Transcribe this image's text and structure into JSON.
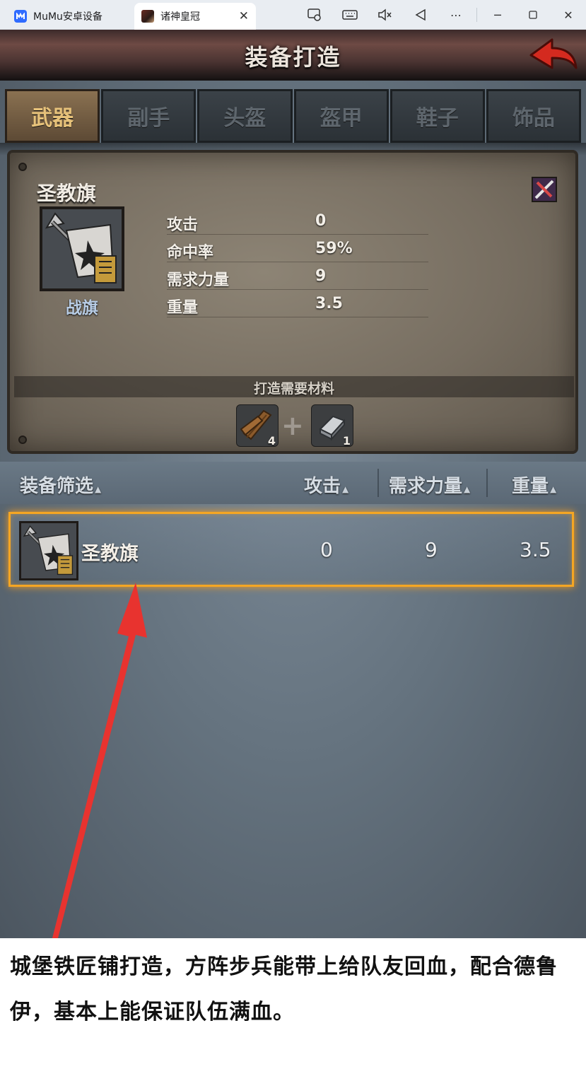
{
  "window": {
    "tabs": [
      {
        "label": "MuMu安卓设备",
        "icon": "mumu-logo-icon"
      },
      {
        "label": "诸神皇冠",
        "icon": "game-icon",
        "active": true
      }
    ],
    "controls": [
      "screen-record-icon",
      "keyboard-icon",
      "mute-icon",
      "back-icon",
      "more-icon",
      "minimize-icon",
      "maximize-icon",
      "close-icon"
    ]
  },
  "header": {
    "title": "装备打造"
  },
  "category_tabs": [
    {
      "label": "武器",
      "active": true
    },
    {
      "label": "副手",
      "active": false
    },
    {
      "label": "头盔",
      "active": false
    },
    {
      "label": "盔甲",
      "active": false
    },
    {
      "label": "鞋子",
      "active": false
    },
    {
      "label": "饰品",
      "active": false
    }
  ],
  "item": {
    "name": "圣教旗",
    "type": "战旗",
    "stats": [
      {
        "label": "攻击",
        "value": "0"
      },
      {
        "label": "命中率",
        "value": "59%"
      },
      {
        "label": "需求力量",
        "value": "9"
      },
      {
        "label": "重量",
        "value": "3.5"
      }
    ]
  },
  "materials": {
    "title": "打造需要材料",
    "items": [
      {
        "icon": "wood-plank-icon",
        "count": "4"
      },
      {
        "icon": "iron-ingot-icon",
        "count": "1"
      }
    ],
    "separator": "+"
  },
  "list": {
    "headers": {
      "filter": "装备筛选",
      "attack": "攻击",
      "strength": "需求力量",
      "weight": "重量"
    },
    "rows": [
      {
        "name": "圣教旗",
        "attack": "0",
        "strength": "9",
        "weight": "3.5",
        "selected": true
      }
    ]
  },
  "colors": {
    "highlight": "#f5a623",
    "annotation_arrow": "#e8332f",
    "active_tab_text": "#e7c27a"
  },
  "caption": "城堡铁匠铺打造，方阵步兵能带上给队友回血，配合德鲁伊，基本上能保证队伍满血。"
}
